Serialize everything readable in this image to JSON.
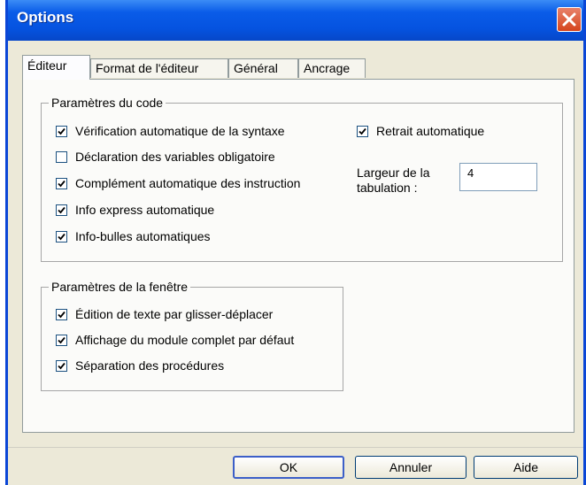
{
  "window": {
    "title": "Options"
  },
  "tabs": [
    {
      "label": "Éditeur",
      "active": true
    },
    {
      "label": "Format de l'éditeur",
      "active": false
    },
    {
      "label": "Général",
      "active": false
    },
    {
      "label": "Ancrage",
      "active": false
    }
  ],
  "code_settings": {
    "legend": "Paramètres du code",
    "options": [
      {
        "label": "Vérification automatique de la syntaxe",
        "checked": true
      },
      {
        "label": "Déclaration des variables obligatoire",
        "checked": false
      },
      {
        "label": "Complément automatique des instruction",
        "checked": true
      },
      {
        "label": "Info express automatique",
        "checked": true
      },
      {
        "label": "Info-bulles automatiques",
        "checked": true
      }
    ],
    "auto_indent": {
      "label": "Retrait automatique",
      "checked": true
    },
    "tab_width": {
      "label_line1": "Largeur de la",
      "label_line2": "tabulation :",
      "value": "4"
    }
  },
  "window_settings": {
    "legend": "Paramètres de la fenêtre",
    "options": [
      {
        "label": "Édition de texte par glisser-déplacer",
        "checked": true
      },
      {
        "label": "Affichage du module complet par défaut",
        "checked": true
      },
      {
        "label": "Séparation des procédures",
        "checked": true
      }
    ]
  },
  "buttons": {
    "ok": "OK",
    "cancel": "Annuler",
    "help": "Aide"
  },
  "colors": {
    "titlebar": "#0553e0",
    "dialog_bg": "#ece9d8",
    "close": "#d5441c",
    "check": "#21a121"
  }
}
